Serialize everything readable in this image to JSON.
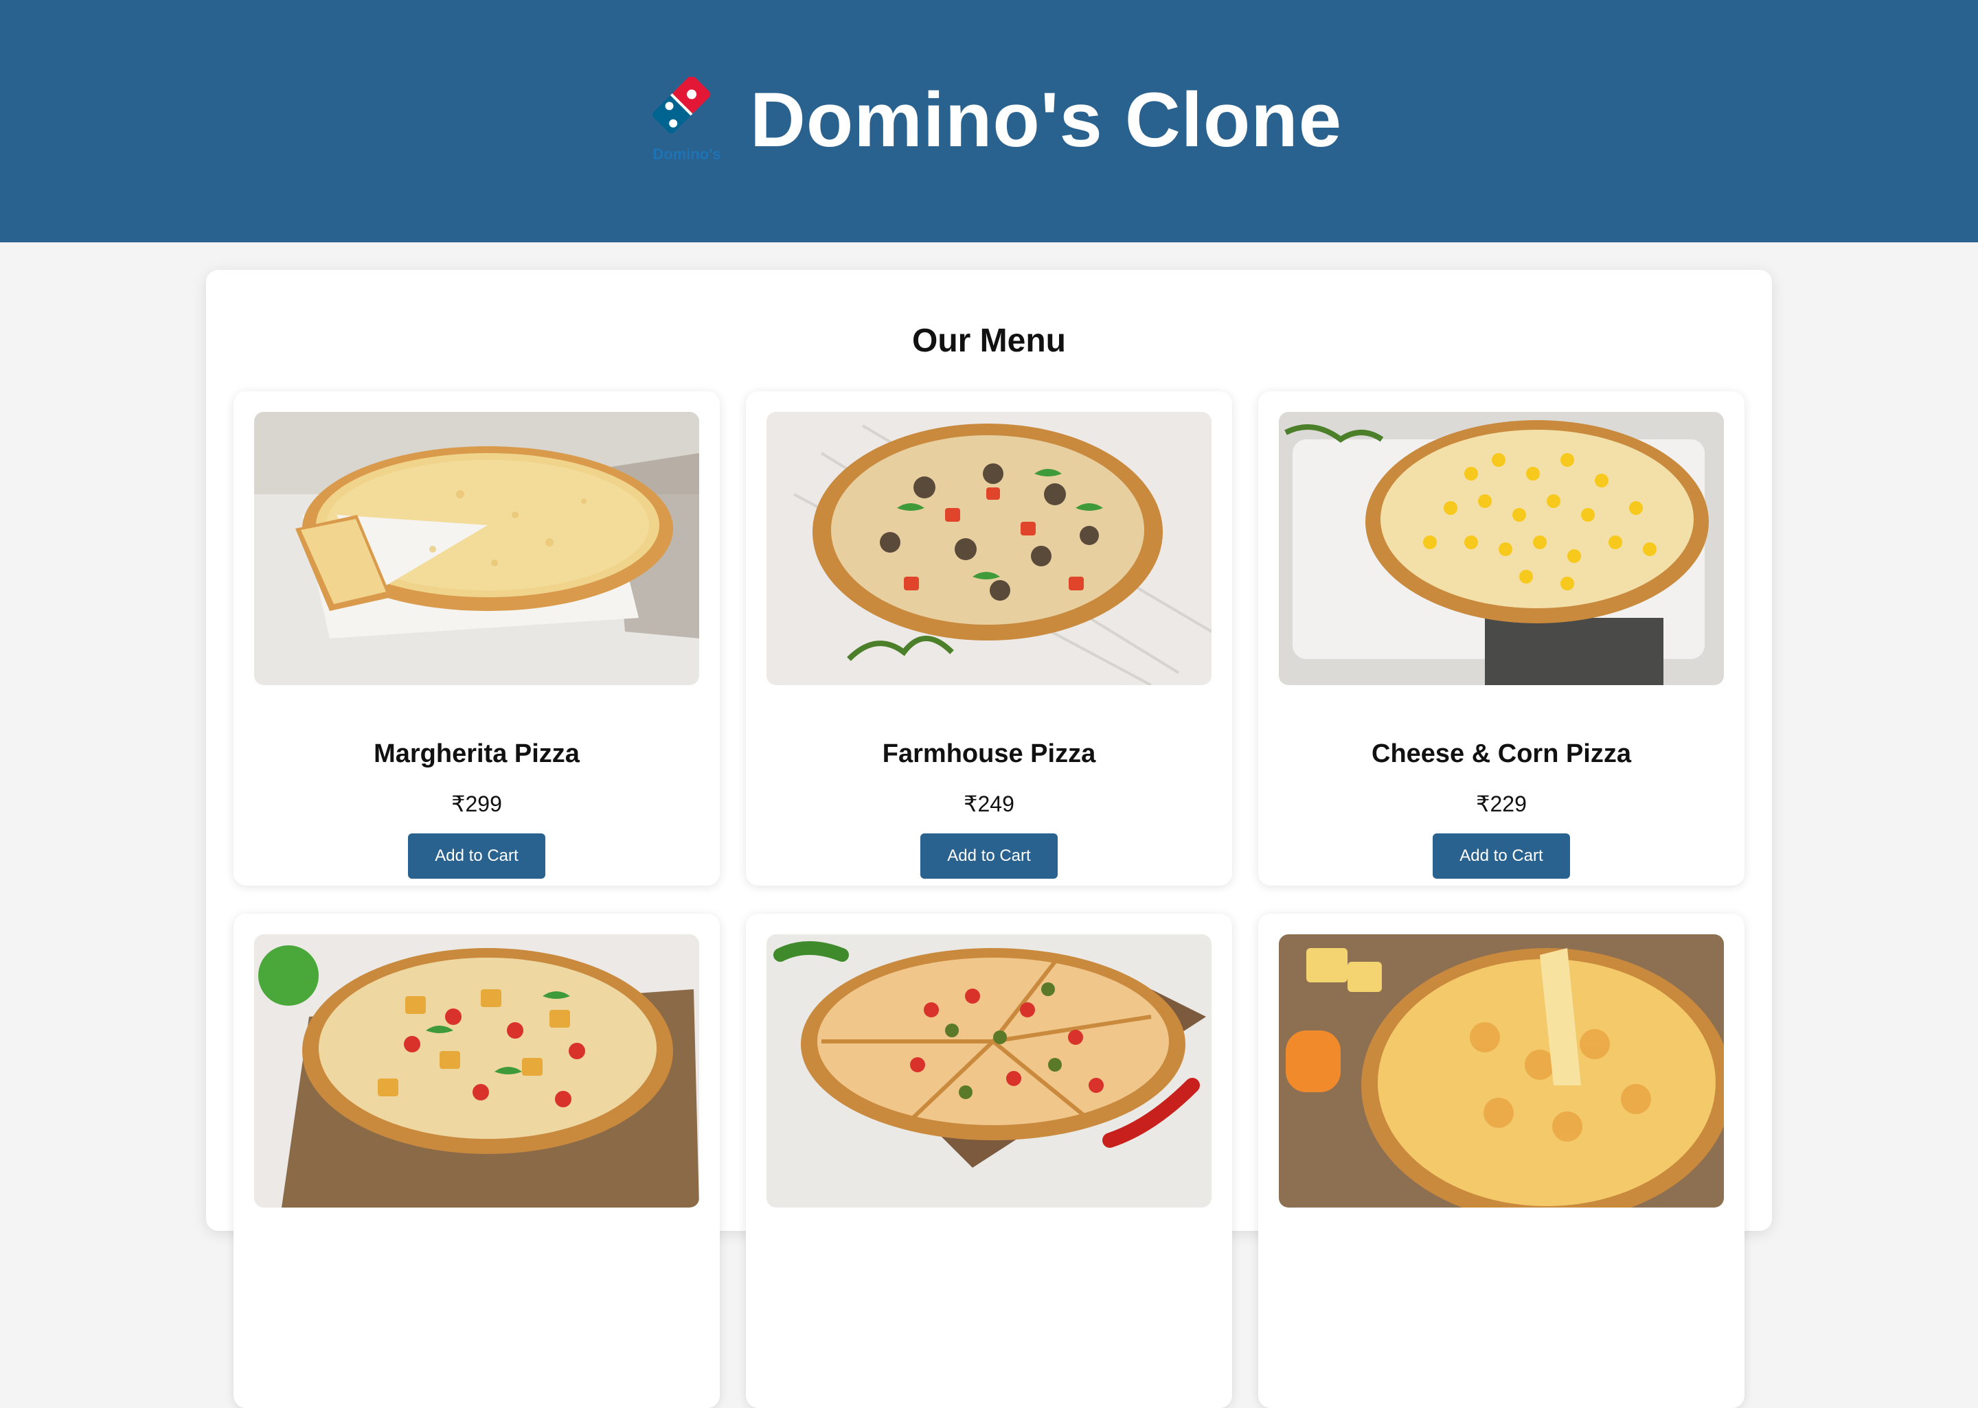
{
  "header": {
    "title": "Domino's Clone",
    "logo_icon": "dominos-logo-icon",
    "logo_text": "Domino's",
    "background_color": "#2a628f"
  },
  "menu": {
    "title": "Our Menu",
    "items": [
      {
        "name": "Margherita Pizza",
        "price": "₹299",
        "button_label": "Add to Cart",
        "image": "margherita-pizza-photo"
      },
      {
        "name": "Farmhouse Pizza",
        "price": "₹249",
        "button_label": "Add to Cart",
        "image": "farmhouse-pizza-photo"
      },
      {
        "name": "Cheese & Corn Pizza",
        "price": "₹229",
        "button_label": "Add to Cart",
        "image": "cheese-corn-pizza-photo"
      },
      {
        "name": "",
        "price": "",
        "button_label": "",
        "image": "paneer-pizza-photo"
      },
      {
        "name": "",
        "price": "",
        "button_label": "",
        "image": "jalapeno-pizza-photo"
      },
      {
        "name": "",
        "price": "",
        "button_label": "",
        "image": "cheese-burst-pizza-photo"
      }
    ]
  },
  "colors": {
    "accent": "#2a628f",
    "page_background": "#f4f4f4",
    "card_background": "#ffffff"
  }
}
